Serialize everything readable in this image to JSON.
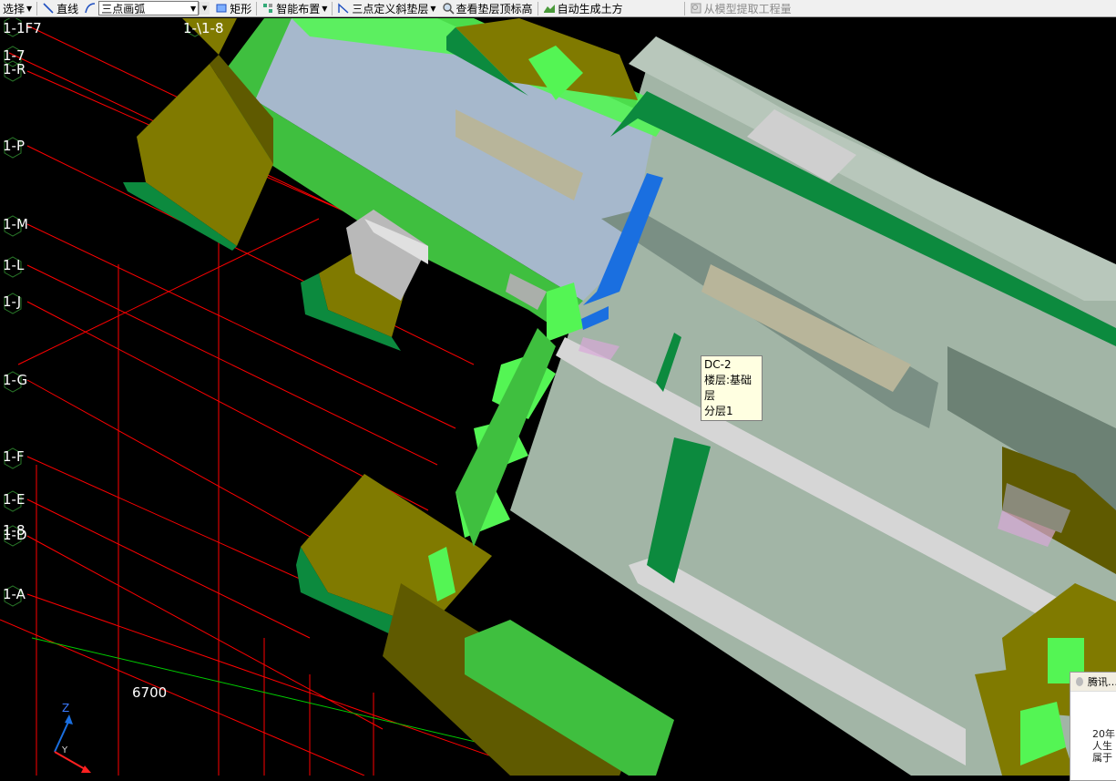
{
  "toolbar": {
    "select_label": "选择",
    "line_label": "直线",
    "arc_combo_value": "三点画弧",
    "rect_label": "矩形",
    "smart_layout_label": "智能布置",
    "three_point_label": "三点定义斜垫层",
    "view_top_label": "查看垫层顶标高",
    "auto_earth_label": "自动生成土方",
    "extract_label": "从模型提取工程量"
  },
  "grid_labels": {
    "g1": "1-1F7",
    "g2": "1-7",
    "g3": "1-R",
    "g4": "1-P",
    "g5": "1-M",
    "g6": "1-L",
    "g7": "1-J",
    "g8": "1-G",
    "g9": "1-F",
    "g10": "1-E",
    "g11": "1-8",
    "g11b": "1-D",
    "g12": "1-A",
    "top2": "1-\\1-8"
  },
  "dimension": "6700",
  "tooltip": {
    "line1": "DC-2",
    "line2": "楼层:基础层",
    "line3": "分层1"
  },
  "axis": {
    "z": "Z",
    "y": "Y"
  },
  "qq_popup": {
    "title": "腾讯…",
    "line1": "20年",
    "line2": "人生",
    "line3": "属于"
  },
  "colors": {
    "bright_green": "#54f554",
    "olive": "#807a00",
    "dark_olive": "#5f5a00",
    "dark_green": "#0c8a3e",
    "slab_gray": "#a2b5a6",
    "blue_slab": "#a6b8cc",
    "highlight_blue": "#1a6fe0",
    "grid_red": "#ff0000"
  }
}
